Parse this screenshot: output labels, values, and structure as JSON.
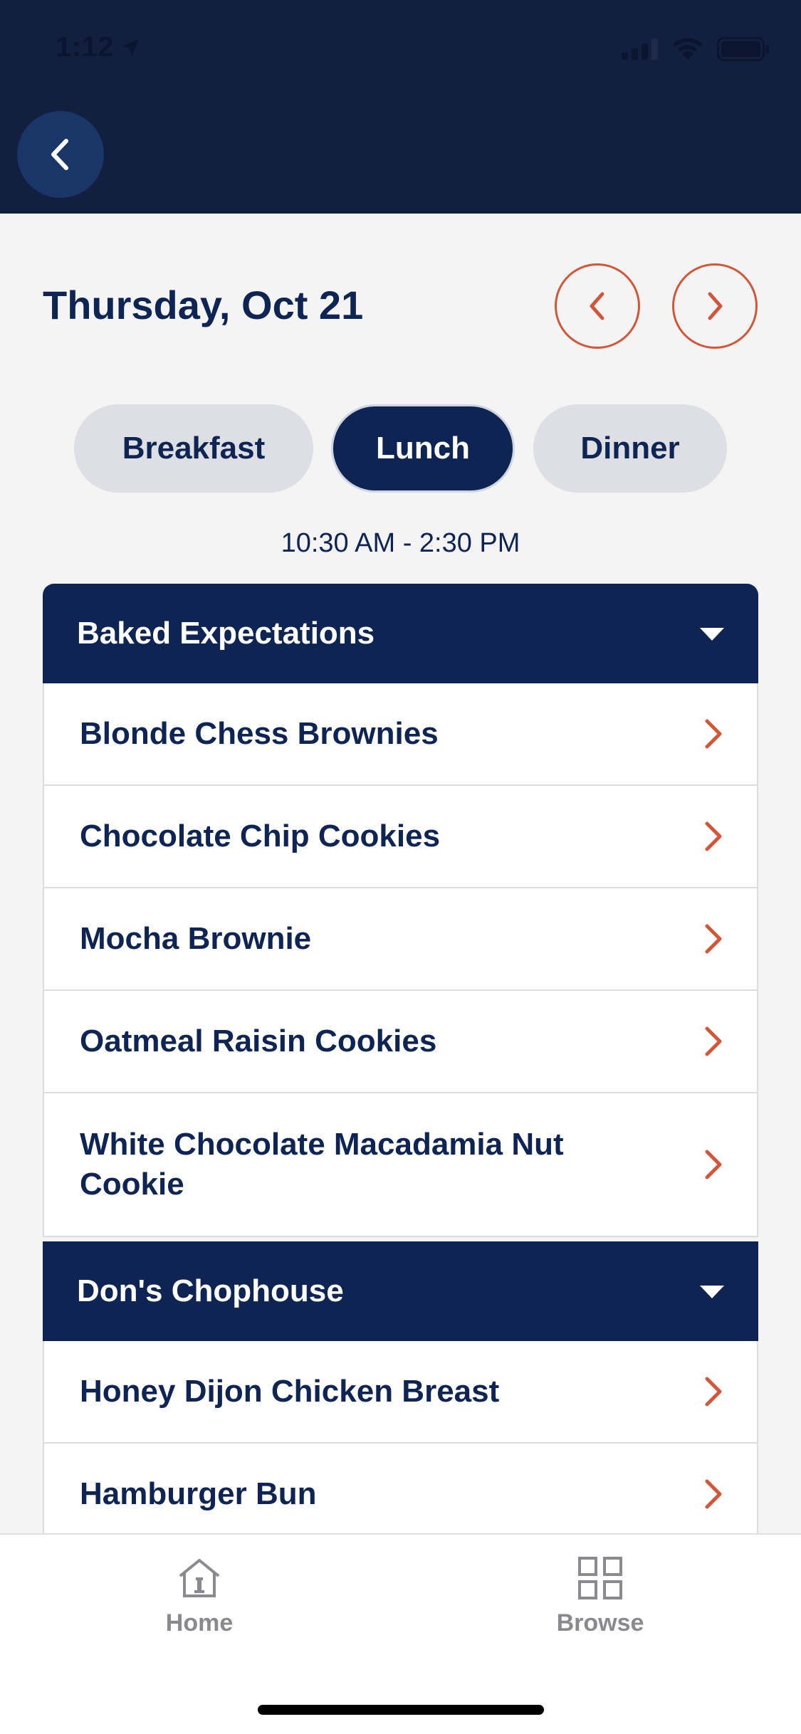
{
  "status_bar": {
    "time": "1:12"
  },
  "header": {
    "back_label": "Back"
  },
  "date": {
    "title": "Thursday, Oct 21"
  },
  "meal_tabs": [
    {
      "label": "Breakfast",
      "selected": false
    },
    {
      "label": "Lunch",
      "selected": true
    },
    {
      "label": "Dinner",
      "selected": false
    }
  ],
  "hours": "10:30 AM - 2:30 PM",
  "sections": [
    {
      "name": "Baked Expectations",
      "items": [
        "Blonde Chess Brownies",
        "Chocolate Chip Cookies",
        "Mocha Brownie",
        "Oatmeal Raisin Cookies",
        "White Chocolate Macadamia Nut Cookie"
      ]
    },
    {
      "name": "Don's Chophouse",
      "items": [
        "Honey Dijon Chicken Breast",
        "Hamburger Bun"
      ]
    }
  ],
  "tabbar": {
    "home": "Home",
    "browse": "Browse"
  },
  "colors": {
    "navy": "#0e2452",
    "accent": "#d0583a",
    "header_bg": "#131f3f"
  }
}
